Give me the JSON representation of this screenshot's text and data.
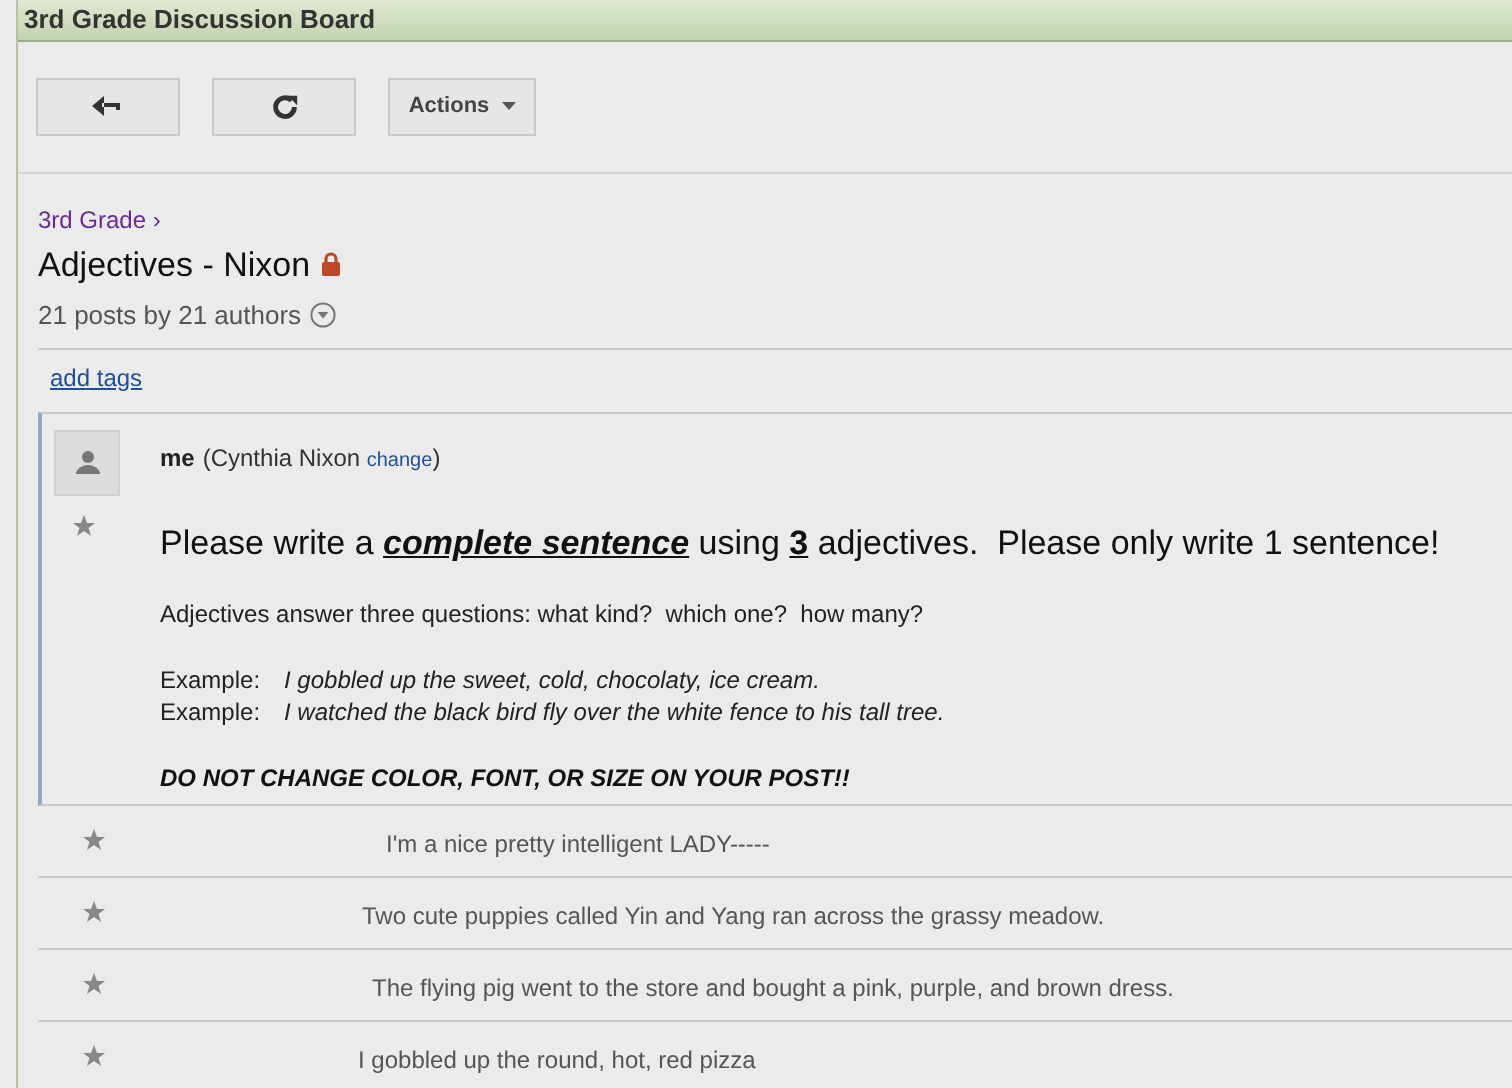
{
  "window": {
    "title": "3rd Grade Discussion Board"
  },
  "toolbar": {
    "actions_label": "Actions"
  },
  "breadcrumb": "3rd Grade ›",
  "topic": {
    "title": "Adjectives - Nixon",
    "summary": "21 posts by 21 authors"
  },
  "add_tags": "add tags",
  "first_post": {
    "author": "me",
    "author_detail_open": "(Cynthia Nixon ",
    "change_link": "change",
    "author_detail_close": ")",
    "heading": [
      {
        "text": "Please write a ",
        "kind": "plain"
      },
      {
        "text": "complete sentence",
        "kind": "emphasis"
      },
      {
        "text": " using ",
        "kind": "plain"
      },
      {
        "text": "3",
        "kind": "strong"
      },
      {
        "text": " adjectives.  Please only write 1 sentence!",
        "kind": "plain"
      }
    ],
    "intro": "Adjectives answer three questions: what kind?  which one?  how many?",
    "examples": [
      {
        "label": "Example:",
        "text": "I gobbled up the sweet, cold, chocolaty, ice cream."
      },
      {
        "label": "Example:",
        "text": "I watched the black bird fly over the white fence to his tall tree."
      }
    ],
    "warning": "DO NOT CHANGE COLOR, FONT, OR SIZE ON YOUR POST!!"
  },
  "replies": [
    {
      "text": "I'm a nice pretty intelligent LADY-----"
    },
    {
      "text": "Two cute puppies called Yin and Yang ran across the grassy meadow."
    },
    {
      "text": "The flying pig went to the store and bought a pink, purple, and brown dress."
    },
    {
      "text": "I gobbled up the round, hot, red pizza"
    }
  ]
}
